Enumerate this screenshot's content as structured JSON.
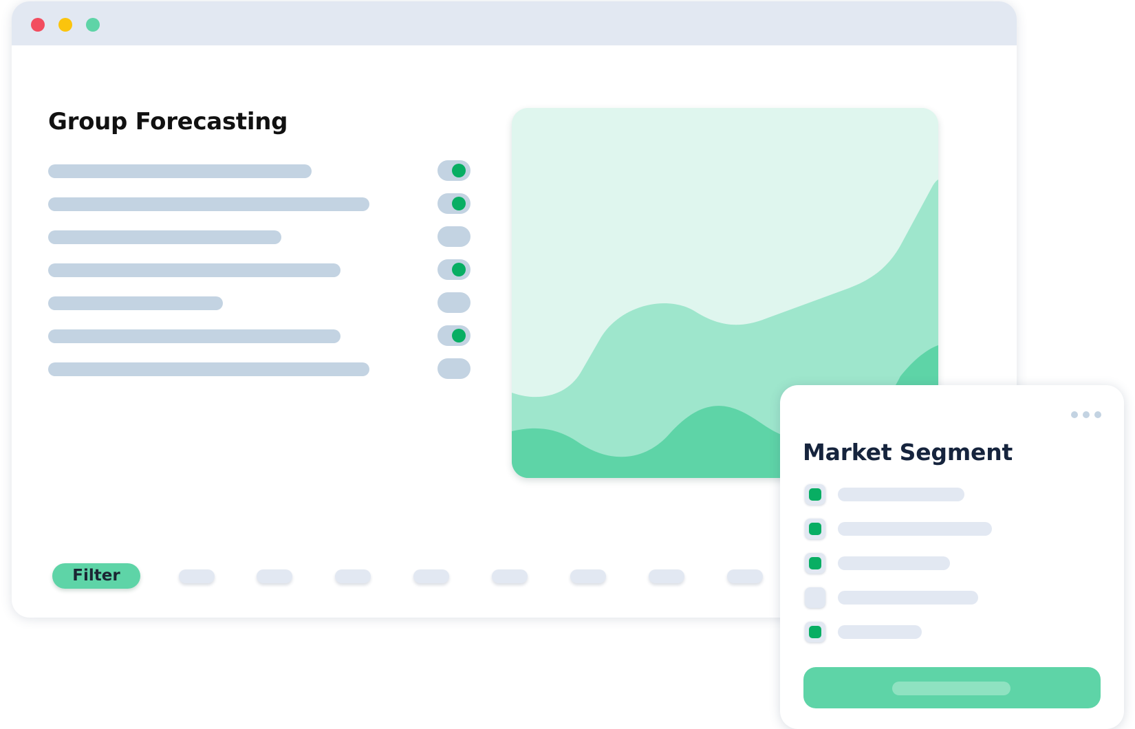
{
  "window": {
    "title": "Group Forecasting",
    "controls": [
      "close",
      "minimize",
      "zoom"
    ]
  },
  "settings": {
    "rows": [
      {
        "enabled": true
      },
      {
        "enabled": true
      },
      {
        "enabled": false
      },
      {
        "enabled": true
      },
      {
        "enabled": false
      },
      {
        "enabled": true
      },
      {
        "enabled": false
      }
    ]
  },
  "chart": {
    "type": "area",
    "layers": 3,
    "colors": [
      "#dff6ee",
      "#9ee6cc",
      "#5ed4a7"
    ]
  },
  "footer": {
    "filter_label": "Filter",
    "page_count": 8
  },
  "market_panel": {
    "title": "Market Segment",
    "items": [
      {
        "checked": true
      },
      {
        "checked": true
      },
      {
        "checked": true
      },
      {
        "checked": false
      },
      {
        "checked": true
      }
    ]
  },
  "colors": {
    "accent": "#5ed4a7",
    "accent_dark": "#08ae63",
    "placeholder": "#c3d3e2",
    "placeholder_light": "#e2e8f2",
    "title_dark": "#16243d"
  },
  "icons": [
    "more-icon"
  ]
}
